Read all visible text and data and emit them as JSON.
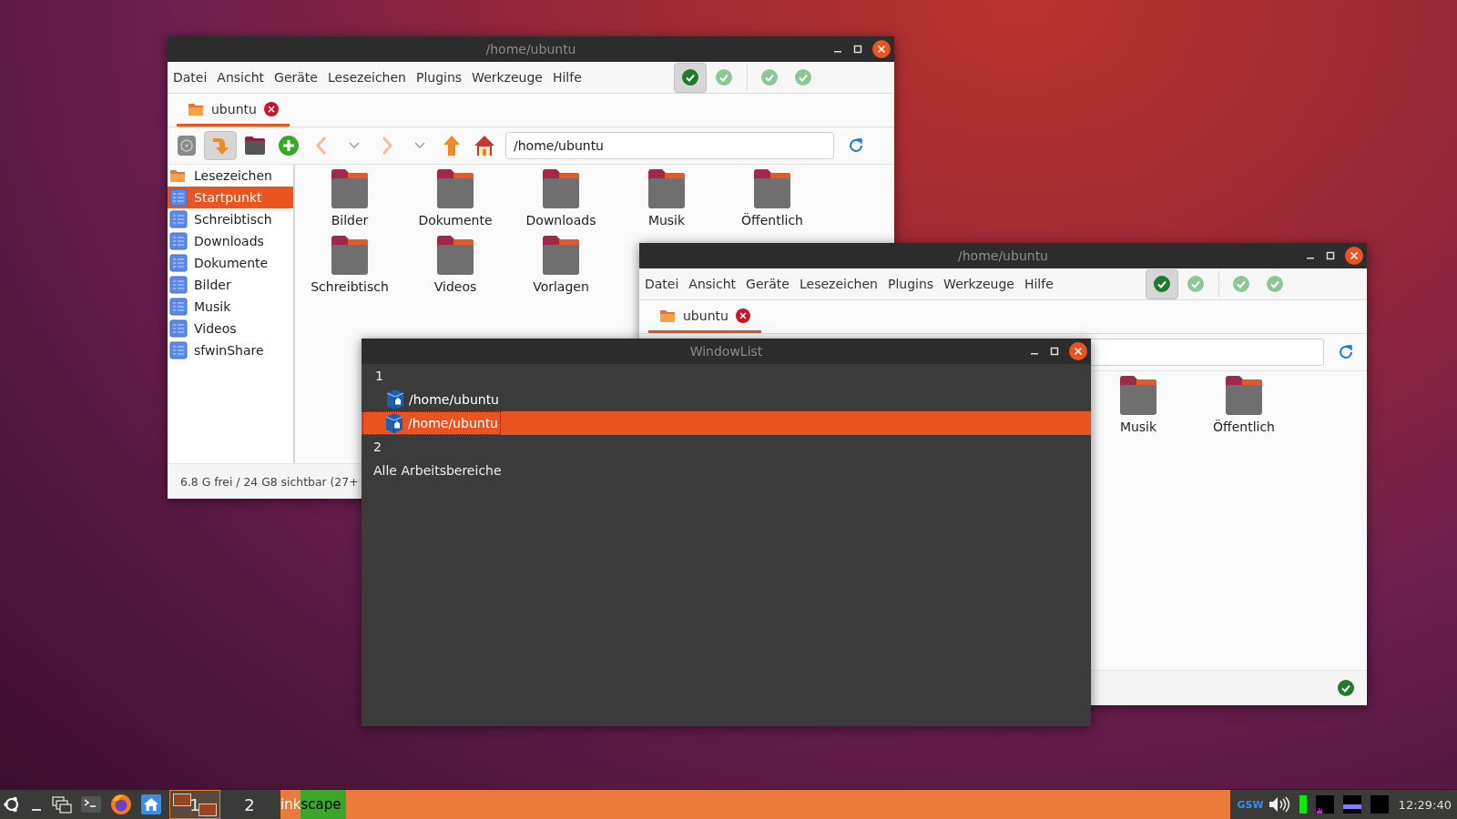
{
  "windows": [
    {
      "title": "/home/ubuntu",
      "menu": [
        "Datei",
        "Ansicht",
        "Geräte",
        "Lesezeichen",
        "Plugins",
        "Werkzeuge",
        "Hilfe"
      ],
      "checks": [
        {
          "selected": true
        },
        {
          "selected": false
        },
        {
          "selected": false
        },
        {
          "selected": false
        }
      ],
      "tabs": [
        {
          "label": "ubuntu",
          "selected": true
        }
      ],
      "toolbar": {
        "toggle_pressed": true,
        "path": "/home/ubuntu"
      },
      "sidebar": {
        "items": [
          {
            "kind": "header",
            "label": "Lesezeichen",
            "selected": false
          },
          {
            "kind": "place",
            "label": "Startpunkt",
            "selected": true
          },
          {
            "kind": "place",
            "label": "Schreibtisch",
            "selected": false
          },
          {
            "kind": "place",
            "label": "Downloads",
            "selected": false
          },
          {
            "kind": "place",
            "label": "Dokumente",
            "selected": false
          },
          {
            "kind": "place",
            "label": "Bilder",
            "selected": false
          },
          {
            "kind": "place",
            "label": "Musik",
            "selected": false
          },
          {
            "kind": "place",
            "label": "Videos",
            "selected": false
          },
          {
            "kind": "place",
            "label": "sfwinShare",
            "selected": false
          }
        ]
      },
      "files": [
        "Bilder",
        "Dokumente",
        "Downloads",
        "Musik",
        "Öffentlich",
        "Schreibtisch",
        "Videos",
        "Vorlagen"
      ],
      "status": "6.8 G frei / 24 G8 sichtbar (27+"
    },
    {
      "title": "/home/ubuntu",
      "menu": [
        "Datei",
        "Ansicht",
        "Geräte",
        "Lesezeichen",
        "Plugins",
        "Werkzeuge",
        "Hilfe"
      ],
      "checks": [
        {
          "selected": true
        },
        {
          "selected": false
        },
        {
          "selected": false
        },
        {
          "selected": false
        }
      ],
      "tabs": [
        {
          "label": "ubuntu",
          "selected": true
        }
      ],
      "files": [
        "Musik",
        "Öffentlich"
      ],
      "status_ok": true
    }
  ],
  "window_list": {
    "title": "WindowList",
    "rows": [
      {
        "kind": "workspace",
        "label": "1"
      },
      {
        "kind": "window",
        "label": "/home/ubuntu",
        "selected": false
      },
      {
        "kind": "window",
        "label": "/home/ubuntu",
        "selected": true
      },
      {
        "kind": "workspace",
        "label": "2"
      },
      {
        "kind": "workspace",
        "label": "Alle Arbeitsbereiche"
      }
    ]
  },
  "taskbar": {
    "workspaces": [
      {
        "label": "1",
        "selected": true
      },
      {
        "label": "2",
        "selected": false
      }
    ],
    "task": {
      "label": "ink",
      "highlight": "scape"
    },
    "keyboard": "GSW",
    "clock": "12:29:40"
  }
}
